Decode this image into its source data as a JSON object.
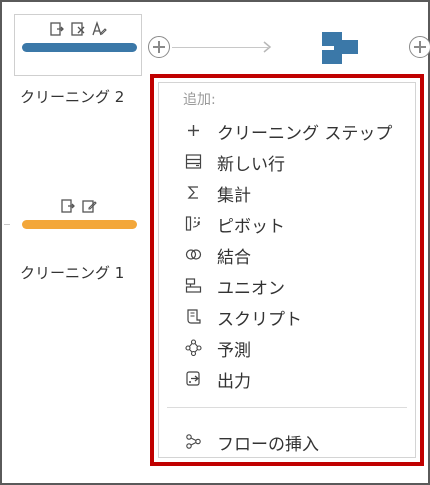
{
  "canvas": {
    "nodes": [
      {
        "label": "クリーニング 2",
        "bar_color": "#3b78a8"
      },
      {
        "label": "クリーニング 1",
        "bar_color": "#f3a73a"
      }
    ]
  },
  "menu": {
    "header": "追加:",
    "items": [
      {
        "label": "クリーニング ステップ",
        "icon": "plus-icon"
      },
      {
        "label": "新しい行",
        "icon": "new-rows-icon"
      },
      {
        "label": "集計",
        "icon": "sigma-icon"
      },
      {
        "label": "ピボット",
        "icon": "pivot-icon"
      },
      {
        "label": "結合",
        "icon": "join-icon"
      },
      {
        "label": "ユニオン",
        "icon": "union-icon"
      },
      {
        "label": "スクリプト",
        "icon": "script-icon"
      },
      {
        "label": "予測",
        "icon": "prediction-icon"
      },
      {
        "label": "出力",
        "icon": "output-icon"
      }
    ],
    "footer_item": {
      "label": "フローの挿入",
      "icon": "insert-flow-icon"
    }
  },
  "colors": {
    "highlight_border": "#c00000",
    "step_blue": "#3b78a8",
    "step_orange": "#f3a73a"
  }
}
